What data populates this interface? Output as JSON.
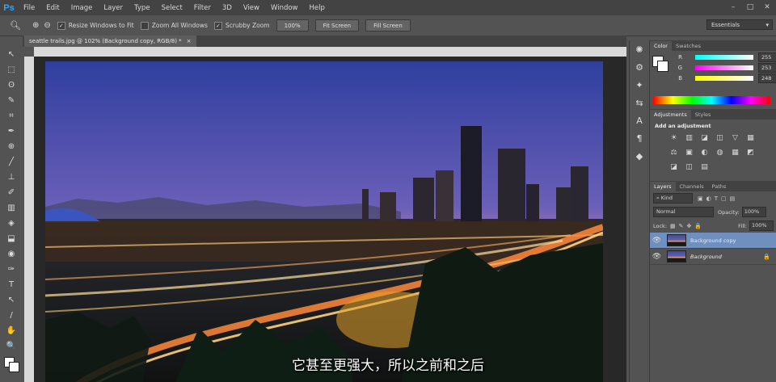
{
  "menubar": {
    "logo": "Ps",
    "items": [
      "File",
      "Edit",
      "Image",
      "Layer",
      "Type",
      "Select",
      "Filter",
      "3D",
      "View",
      "Window",
      "Help"
    ],
    "window_buttons": [
      "–",
      "□",
      "✕"
    ]
  },
  "options": {
    "resize_windows": "Resize Windows to Fit",
    "zoom_all": "Zoom All Windows",
    "scrubby_zoom": "Scrubby Zoom",
    "zoom_100": "100%",
    "fit_screen": "Fit Screen",
    "fill_screen": "Fill Screen",
    "workspace": "Essentials"
  },
  "document": {
    "tab_title": "seattle trails.jpg @ 102% (Background copy, RGB/8) *",
    "tab_close": "×"
  },
  "tools": [
    "↖",
    "⬚",
    "ʘ",
    "✎",
    "⌗",
    "✒",
    "⊕",
    "╱",
    "⊥",
    "✐",
    "▥",
    "◈",
    "⬓",
    "◉",
    "✑",
    "T",
    "↖",
    "/",
    "✋",
    "🔍"
  ],
  "panels": {
    "color_tabs": [
      "Color",
      "Swatches"
    ],
    "color_sliders": [
      {
        "label": "R",
        "value": "255"
      },
      {
        "label": "G",
        "value": "253"
      },
      {
        "label": "B",
        "value": "248"
      }
    ],
    "adjust_tabs": [
      "Adjustments",
      "Styles"
    ],
    "adjust_title": "Add an adjustment",
    "adjust_icons": [
      "☀",
      "▥",
      "◪",
      "◫",
      "▽",
      "▦",
      "⚖",
      "▣",
      "◐",
      "◍",
      "▦",
      "◩",
      "◪",
      "◫",
      "▤"
    ],
    "layers_tabs": [
      "Layers",
      "Channels",
      "Paths"
    ],
    "kind": "Kind",
    "blend_mode": "Normal",
    "opacity_label": "Opacity:",
    "opacity_value": "100%",
    "lock_label": "Lock:",
    "fill_label": "Fill:",
    "fill_value": "100%",
    "layers": [
      {
        "name": "Background copy",
        "selected": true
      },
      {
        "name": "Background",
        "selected": false,
        "locked": true
      }
    ]
  },
  "dock_icons": [
    "✺",
    "⚙",
    "✦",
    "⇆",
    "A",
    "¶",
    "◆"
  ],
  "subtitle": "它甚至更强大，所以之前和之后",
  "colors": {
    "accent": "#31a8ff",
    "panel": "#535353",
    "dark": "#424242"
  }
}
